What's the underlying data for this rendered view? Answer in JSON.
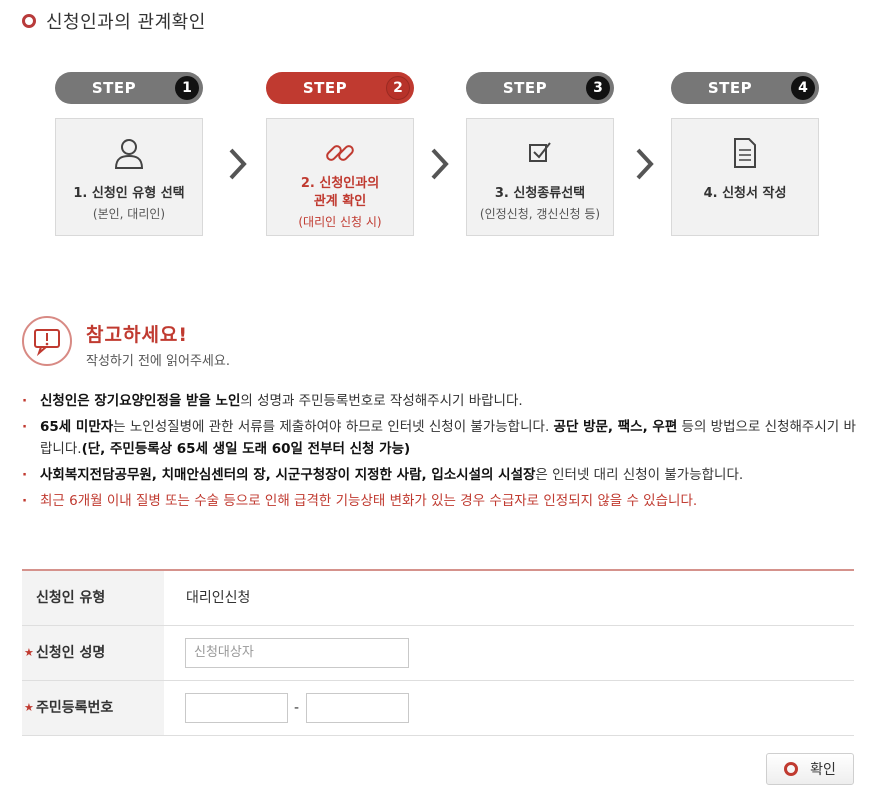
{
  "page_title": "신청인과의 관계확인",
  "steps": [
    {
      "label": "STEP",
      "num": "1",
      "title": "1. 신청인 유형 선택",
      "sub": "(본인, 대리인)",
      "icon": "user-icon",
      "active": false
    },
    {
      "label": "STEP",
      "num": "2",
      "title": "2. 신청인과의\n관계 확인",
      "sub": "(대리인 신청 시)",
      "icon": "link-icon",
      "active": true
    },
    {
      "label": "STEP",
      "num": "3",
      "title": "3. 신청종류선택",
      "sub": "(인정신청, 갱신신청 등)",
      "icon": "checkbox-icon",
      "active": false
    },
    {
      "label": "STEP",
      "num": "4",
      "title": "4. 신청서 작성",
      "sub": "",
      "icon": "document-icon",
      "active": false
    }
  ],
  "notice": {
    "title": "참고하세요!",
    "subtitle": "작성하기 전에 읽어주세요."
  },
  "notes": [
    {
      "bold1": "신청인은 장기요양인정을 받을 노인",
      "text1": "의 성명과 주민등록번호로 작성해주시기 바랍니다."
    },
    {
      "bold1": "65세 미만자",
      "text1": "는 노인성질병에 관한 서류를 제출하여야 하므로 인터넷 신청이 불가능합니다. ",
      "bold2": "공단 방문, 팩스, 우편",
      "text2": " 등의 방법으로 신청해주시기 바랍니다.",
      "bold3": "(단, 주민등록상 65세 생일 도래 60일 전부터 신청 가능)"
    },
    {
      "bold1": "사회복지전담공무원, 치매안심센터의 장, 시군구청장이 지정한 사람, 입소시설의 시설장",
      "text1": "은 인터넷 대리 신청이 불가능합니다."
    },
    {
      "text1": "최근 6개월 이내 질병 또는 수술 등으로 인해 급격한 기능상태 변화가 있는 경우 수급자로 인정되지 않을 수 있습니다."
    }
  ],
  "form": {
    "type_label": "신청인 유형",
    "type_value": "대리인신청",
    "name_label": "신청인 성명",
    "name_placeholder": "신청대상자",
    "rrn_label": "주민등록번호",
    "rrn_separator": "-",
    "required_mark": "★"
  },
  "confirm_label": "확인",
  "colors": {
    "accent": "#c03a30",
    "inactive_pill": "#777777",
    "box_bg": "#f2f2f2"
  }
}
